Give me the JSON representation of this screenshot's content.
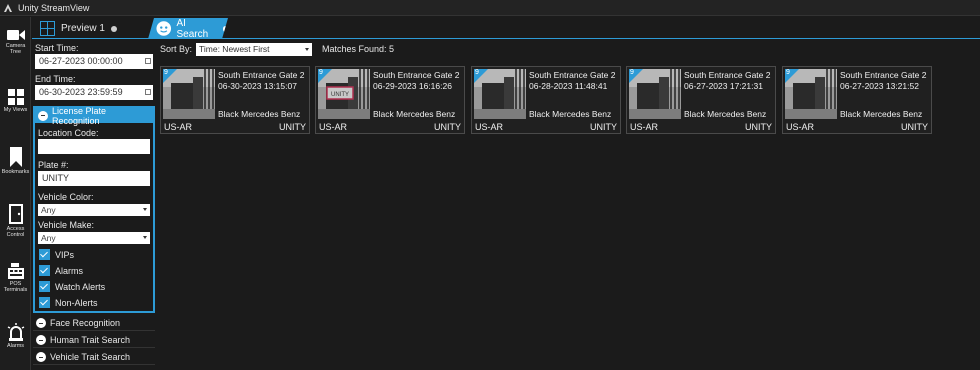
{
  "window": {
    "title": "Unity StreamView"
  },
  "nav": {
    "items": [
      {
        "label1": "Camera",
        "label2": "Tree",
        "icon": "camera-icon"
      },
      {
        "label1": "My Views",
        "label2": "",
        "icon": "grid-icon"
      },
      {
        "label1": "Bookmarks",
        "label2": "",
        "icon": "bookmark-icon"
      },
      {
        "label1": "Access",
        "label2": "Control",
        "icon": "door-icon"
      },
      {
        "label1": "POS",
        "label2": "Terminals",
        "icon": "register-icon"
      },
      {
        "label1": "Alarms",
        "label2": "",
        "icon": "alarm-icon"
      }
    ]
  },
  "tabs": [
    {
      "label": "Preview 1",
      "icon": "grid-icon",
      "active": false
    },
    {
      "label": "AI Search",
      "icon": "ai-face-icon",
      "active": true
    }
  ],
  "filters": {
    "start_label": "Start Time:",
    "start_value": "06-27-2023 00:00:00",
    "end_label": "End Time:",
    "end_value": "06-30-2023 23:59:59",
    "lpr": {
      "title": "License Plate Recognition",
      "location_label": "Location Code:",
      "location_value": "",
      "plate_label": "Plate #:",
      "plate_value": "UNITY",
      "color_label": "Vehicle Color:",
      "color_value": "Any",
      "make_label": "Vehicle Make:",
      "make_value": "Any",
      "checks": [
        {
          "label": "VIPs",
          "checked": true
        },
        {
          "label": "Alarms",
          "checked": true
        },
        {
          "label": "Watch Alerts",
          "checked": true
        },
        {
          "label": "Non-Alerts",
          "checked": true
        }
      ]
    },
    "sections": [
      "Face Recognition",
      "Human Trait Search",
      "Vehicle Trait Search"
    ]
  },
  "results": {
    "sort_label": "Sort By:",
    "sort_value": "Time: Newest First",
    "matches": "Matches Found: 5",
    "cards": [
      {
        "badge": "9",
        "location": "South Entrance Gate 2",
        "timestamp": "06-30-2023 13:15:07",
        "vehicle": "Black Mercedes Benz",
        "region": "US-AR",
        "plate": "UNITY"
      },
      {
        "badge": "9",
        "location": "South Entrance Gate 2",
        "timestamp": "06-29-2023 16:16:26",
        "vehicle": "Black Mercedes Benz",
        "region": "US-AR",
        "plate": "UNITY"
      },
      {
        "badge": "9",
        "location": "South Entrance Gate 2",
        "timestamp": "06-28-2023 11:48:41",
        "vehicle": "Black Mercedes Benz",
        "region": "US-AR",
        "plate": "UNITY"
      },
      {
        "badge": "9",
        "location": "South Entrance Gate 2",
        "timestamp": "06-27-2023 17:21:31",
        "vehicle": "Black Mercedes Benz",
        "region": "US-AR",
        "plate": "UNITY"
      },
      {
        "badge": "9",
        "location": "South Entrance Gate 2",
        "timestamp": "06-27-2023 13:21:52",
        "vehicle": "Black Mercedes Benz",
        "region": "US-AR",
        "plate": "UNITY"
      }
    ]
  },
  "colors": {
    "accent": "#2d9bd6",
    "background": "#1b1b1b"
  }
}
